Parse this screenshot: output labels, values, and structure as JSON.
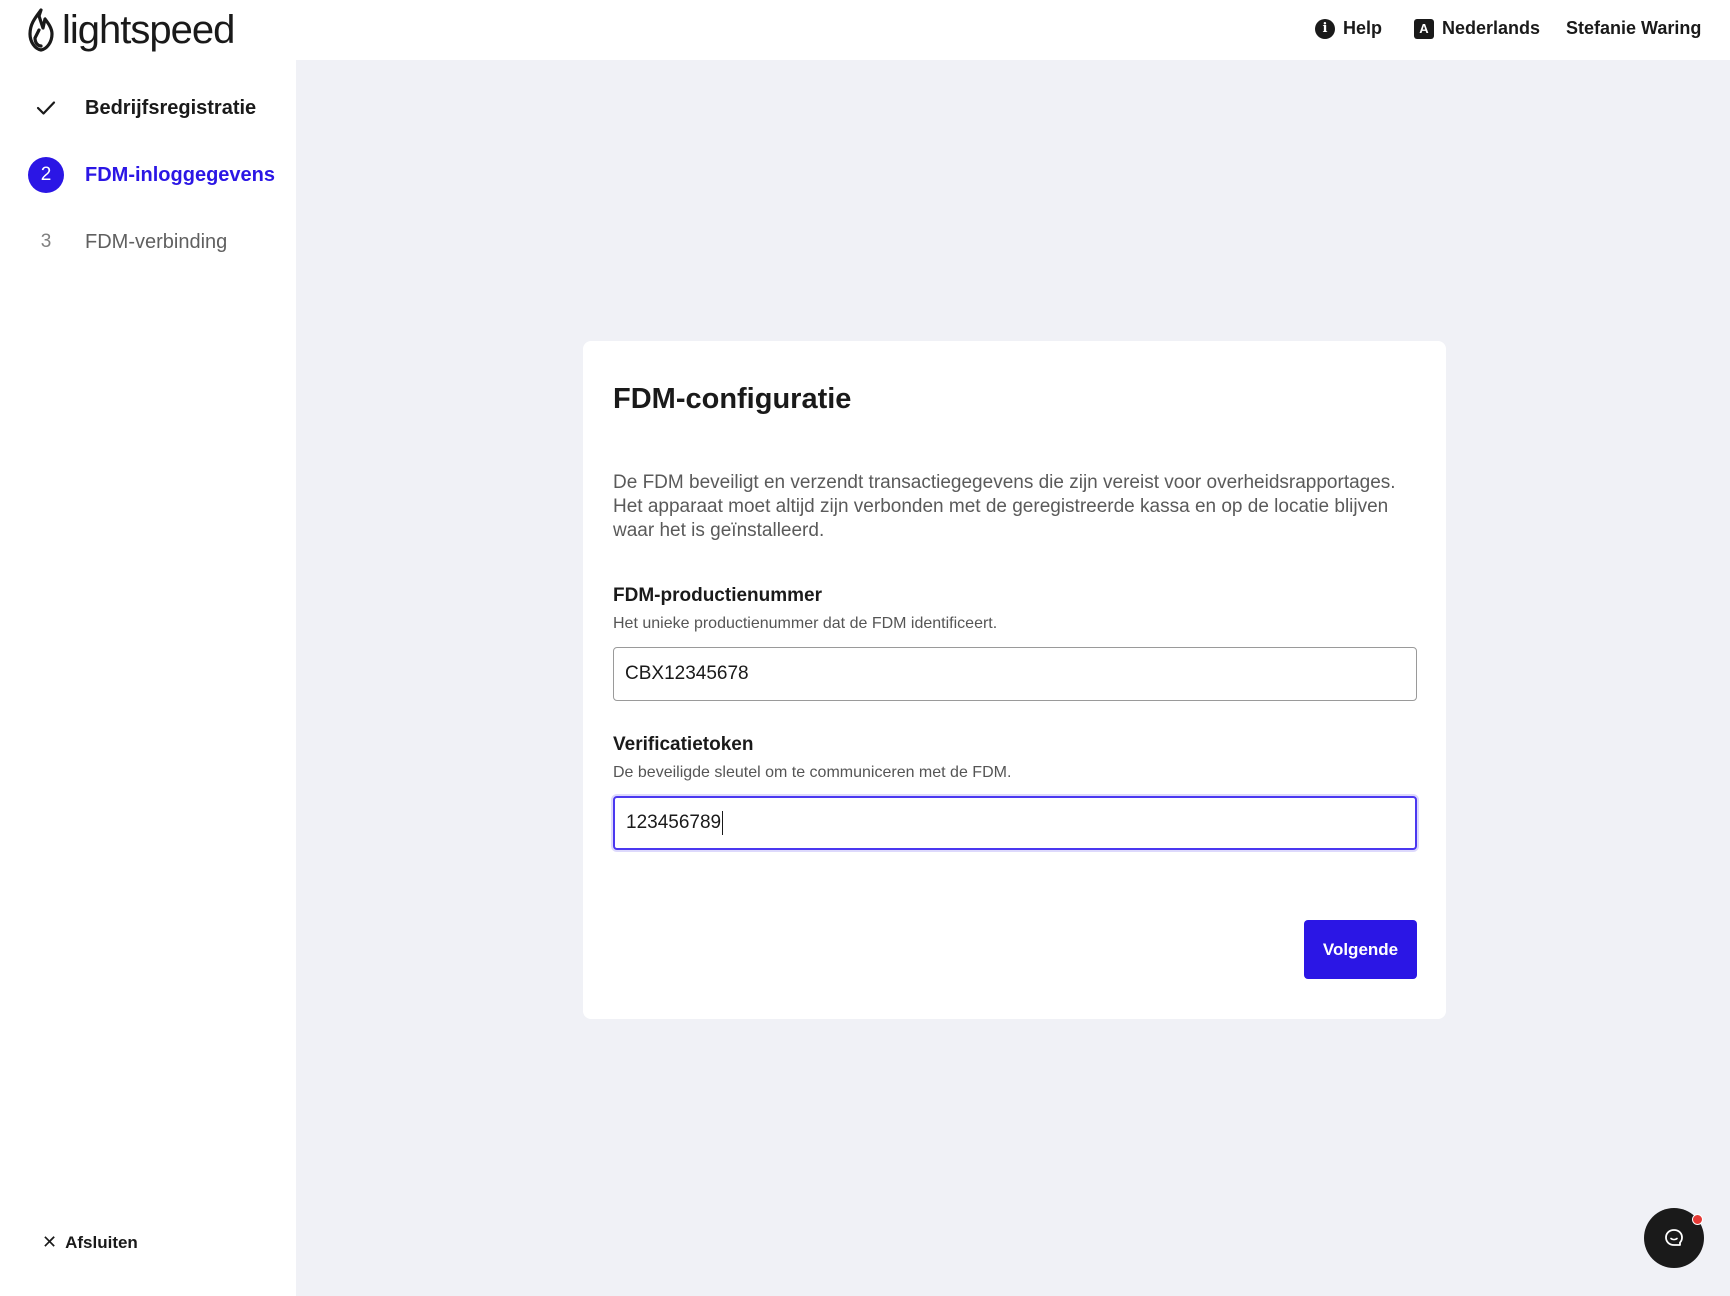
{
  "header": {
    "logo_text": "lightspeed",
    "help_label": "Help",
    "help_icon": "info-icon",
    "language_label": "Nederlands",
    "language_icon": "language-icon",
    "user_name": "Stefanie Waring"
  },
  "sidebar": {
    "steps": [
      {
        "marker": "✓",
        "label": "Bedrijfsregistratie",
        "state": "completed"
      },
      {
        "marker": "2",
        "label": "FDM-inloggegevens",
        "state": "active"
      },
      {
        "marker": "3",
        "label": "FDM-verbinding",
        "state": "pending"
      }
    ],
    "exit_label": "Afsluiten",
    "exit_icon": "close-icon"
  },
  "card": {
    "title": "FDM-configuratie",
    "description": "De FDM beveiligt en verzendt transactiegegevens die zijn vereist voor overheidsrapportages. Het apparaat moet altijd zijn verbonden met de geregistreerde kassa en op de locatie blijven waar het is geïnstalleerd.",
    "fields": [
      {
        "label": "FDM-productienummer",
        "help": "Het unieke productienummer dat de FDM identificeert.",
        "value": "CBX12345678"
      },
      {
        "label": "Verificatietoken",
        "help": "De beveiligde sleutel om te communiceren met de FDM.",
        "value": "123456789"
      }
    ],
    "next_label": "Volgende"
  },
  "colors": {
    "accent": "#2b16e5",
    "background": "#f0f1f6",
    "notification": "#e53935"
  },
  "chat": {
    "icon": "chat-icon"
  }
}
